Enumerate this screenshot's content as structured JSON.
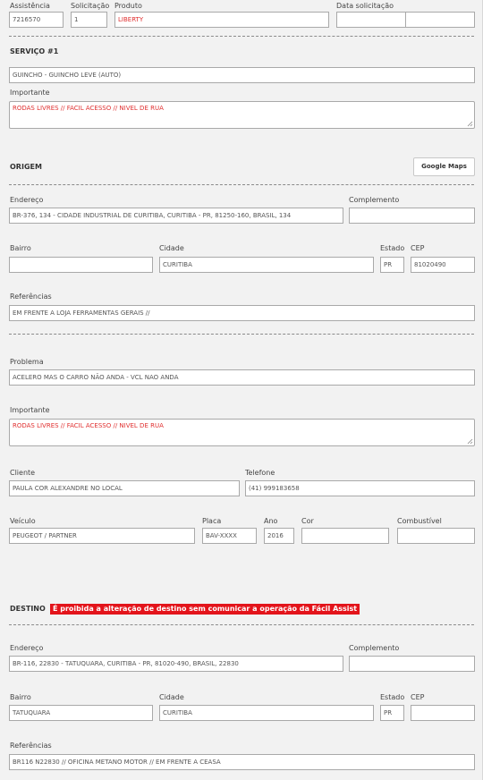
{
  "header": {
    "assistencia_label": "Assistência",
    "assistencia_value": "7216570",
    "solicitacao_label": "Solicitação",
    "solicitacao_value": "1",
    "produto_label": "Produto",
    "produto_value": "LIBERTY",
    "data_solicitacao_label": "Data solicitação",
    "data_value": "",
    "hora_value": ""
  },
  "servico": {
    "title": "SERVIÇO #1",
    "tipo_value": "GUINCHO - GUINCHO LEVE (AUTO)",
    "importante_label": "Importante",
    "importante_value": "RODAS LIVRES // FACIL ACESSO // NIVEL DE RUA"
  },
  "origem": {
    "title": "ORIGEM",
    "maps_button": "Google Maps",
    "endereco_label": "Endereço",
    "endereco_value": "BR-376, 134 - CIDADE INDUSTRIAL DE CURITIBA, CURITIBA - PR, 81250-160, BRASIL, 134",
    "complemento_label": "Complemento",
    "complemento_value": "",
    "bairro_label": "Bairro",
    "bairro_value": "",
    "cidade_label": "Cidade",
    "cidade_value": "CURITIBA",
    "estado_label": "Estado",
    "estado_value": "PR",
    "cep_label": "CEP",
    "cep_value": "81020490",
    "referencias_label": "Referências",
    "referencias_value": "EM FRENTE A LOJA FERRAMENTAS GERAIS //"
  },
  "problema": {
    "problema_label": "Problema",
    "problema_value": "ACELERO MAS O CARRO NÃO ANDA - VCL NAO ANDA",
    "importante_label": "Importante",
    "importante_value": "RODAS LIVRES // FACIL ACESSO // NIVEL DE RUA",
    "cliente_label": "Cliente",
    "cliente_value": "PAULA COR ALEXANDRE NO LOCAL",
    "telefone_label": "Telefone",
    "telefone_value": "(41) 999183658",
    "veiculo_label": "Veículo",
    "veiculo_value": "PEUGEOT / PARTNER",
    "placa_label": "Placa",
    "placa_value": "BAV-XXXX",
    "ano_label": "Ano",
    "ano_value": "2016",
    "cor_label": "Cor",
    "cor_value": "",
    "combustivel_label": "Combustível",
    "combustivel_value": ""
  },
  "destino": {
    "title": "DESTINO",
    "warning": "É proibida a alteração de destino sem comunicar a operação da Fácil Assist",
    "endereco_label": "Endereço",
    "endereco_value": "BR-116, 22830 - TATUQUARA, CURITIBA - PR, 81020-490, BRASIL, 22830",
    "complemento_label": "Complemento",
    "complemento_value": "",
    "bairro_label": "Bairro",
    "bairro_value": "TATUQUARA",
    "cidade_label": "Cidade",
    "cidade_value": "CURITIBA",
    "estado_label": "Estado",
    "estado_value": "PR",
    "cep_label": "CEP",
    "cep_value": "",
    "referencias_label": "Referências",
    "referencias_value": "BR116 N22830 // OFICINA METANO MOTOR // EM FRENTE A CEASA"
  },
  "colors": {
    "warning_bg": "#e3141b",
    "important_text": "#e03030"
  }
}
